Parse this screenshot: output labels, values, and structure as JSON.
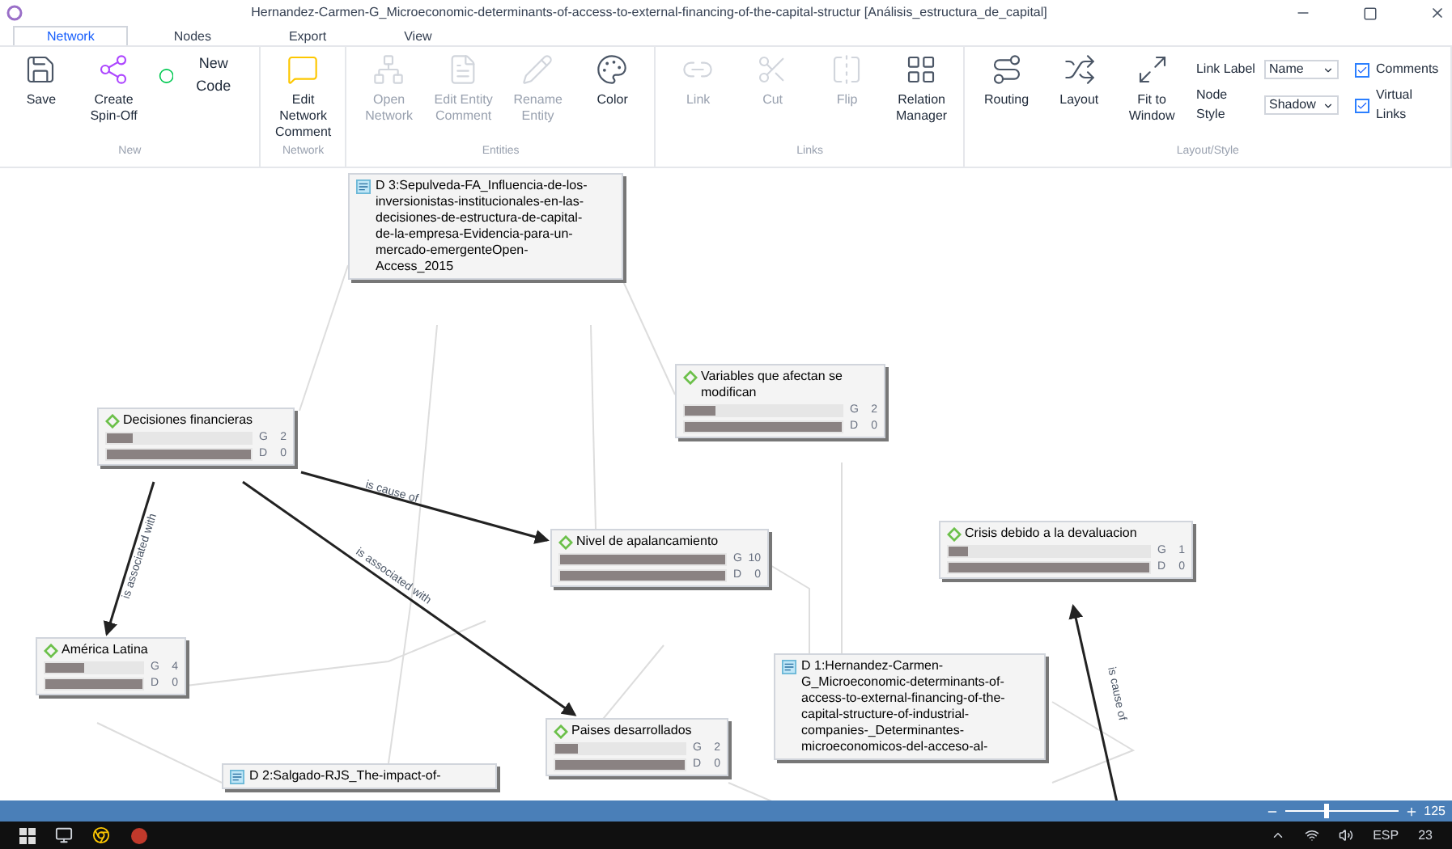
{
  "window": {
    "title": "Hernandez-Carmen-G_Microeconomic-determinants-of-access-to-external-financing-of-the-capital-structur [Análisis_estructura_de_capital]"
  },
  "tabs": [
    {
      "label": "Network",
      "selected": true
    },
    {
      "label": "Nodes",
      "selected": false
    },
    {
      "label": "Export",
      "selected": false
    },
    {
      "label": "View",
      "selected": false
    }
  ],
  "ribbon": [
    {
      "group": "New",
      "items": [
        {
          "label": "Save",
          "kind": "save",
          "disabled": false
        },
        {
          "label": "Create Spin-Off",
          "kind": "spinoff",
          "disabled": false
        },
        {
          "label": "New Code",
          "kind": "newcode",
          "disabled": false
        }
      ]
    },
    {
      "group": "Network",
      "items": [
        {
          "label": "Edit Network Comment",
          "kind": "comment",
          "disabled": false
        }
      ]
    },
    {
      "group": "Entities",
      "items": [
        {
          "label": "Open Network",
          "kind": "open",
          "disabled": true
        },
        {
          "label": "Edit Entity Comment",
          "kind": "entitycomment",
          "disabled": true
        },
        {
          "label": "Rename Entity",
          "kind": "rename",
          "disabled": true
        },
        {
          "label": "Color",
          "kind": "color",
          "disabled": false
        }
      ]
    },
    {
      "group": "Links",
      "items": [
        {
          "label": "Link",
          "kind": "link",
          "disabled": true
        },
        {
          "label": "Cut",
          "kind": "cut",
          "disabled": true
        },
        {
          "label": "Flip",
          "kind": "flip",
          "disabled": true
        },
        {
          "label": "Relation Manager",
          "kind": "relations",
          "disabled": false
        }
      ]
    },
    {
      "group": "Layout/Style",
      "items": [
        {
          "label": "Routing",
          "kind": "routing",
          "disabled": false
        },
        {
          "label": "Layout",
          "kind": "layout",
          "disabled": false
        },
        {
          "label": "Fit to Window",
          "kind": "fit",
          "disabled": false
        }
      ],
      "selects": [
        {
          "label": "Link Label",
          "value": "Name"
        },
        {
          "label": "Node Style",
          "value": "Shadow"
        }
      ],
      "checkboxes": [
        {
          "label": "Comments",
          "checked": true
        },
        {
          "label": "Virtual Links",
          "checked": true
        }
      ]
    }
  ],
  "nodes": [
    {
      "kind": "document",
      "prefix": "D 3:",
      "name": "Sepulveda-FA_Influencia-de-los-inversionistas-institucionales-en-las-decisiones-de-estructura-de-capital-de-la-empresa-Evidencia-para-un-mercado-emergenteOpen-Access_2015"
    },
    {
      "kind": "code",
      "name": "Decisiones financieras",
      "bars": [
        {
          "label": "G",
          "count": "2",
          "level": 0.18
        },
        {
          "label": "D",
          "count": "0",
          "level": 1
        }
      ]
    },
    {
      "kind": "code",
      "name": "Variables que afectan se modifican",
      "bars": [
        {
          "label": "G",
          "count": "2",
          "level": 0.2
        },
        {
          "label": "D",
          "count": "0",
          "level": 1
        }
      ]
    },
    {
      "kind": "code",
      "name": "Nivel de apalancamiento",
      "bars": [
        {
          "label": "G",
          "count": "10",
          "level": 1
        },
        {
          "label": "D",
          "count": "0",
          "level": 1
        }
      ]
    },
    {
      "kind": "code",
      "name": "Crisis debido a la devaluacion",
      "bars": [
        {
          "label": "G",
          "count": "1",
          "level": 0.1
        },
        {
          "label": "D",
          "count": "0",
          "level": 1
        }
      ]
    },
    {
      "kind": "code",
      "name": "América Latina",
      "bars": [
        {
          "label": "G",
          "count": "4",
          "level": 0.4
        },
        {
          "label": "D",
          "count": "0",
          "level": 1
        }
      ]
    },
    {
      "kind": "document",
      "prefix": "D 2:",
      "name": "Salgado-RJS_The-impact-of-"
    },
    {
      "kind": "code",
      "name": "Paises desarrollados",
      "bars": [
        {
          "label": "G",
          "count": "2",
          "level": 0.18
        },
        {
          "label": "D",
          "count": "0",
          "level": 1
        }
      ]
    },
    {
      "kind": "document",
      "prefix": "D 1:",
      "name": "Hernandez-Carmen-G_Microeconomic-determinants-of-access-to-external-financing-of-the-capital-structure-of-industrial-companies-_Determinantes-microeconomicos-del-acceso-al-"
    }
  ],
  "links": [
    {
      "label": "is cause of"
    },
    {
      "label": "is associated with"
    },
    {
      "label": "is associated with"
    },
    {
      "label": "is cause of"
    }
  ],
  "status_bar": {
    "zoom": {
      "level": 0.35,
      "reading": "125"
    }
  },
  "taskbar": {
    "language": "ESP",
    "time": "23"
  }
}
